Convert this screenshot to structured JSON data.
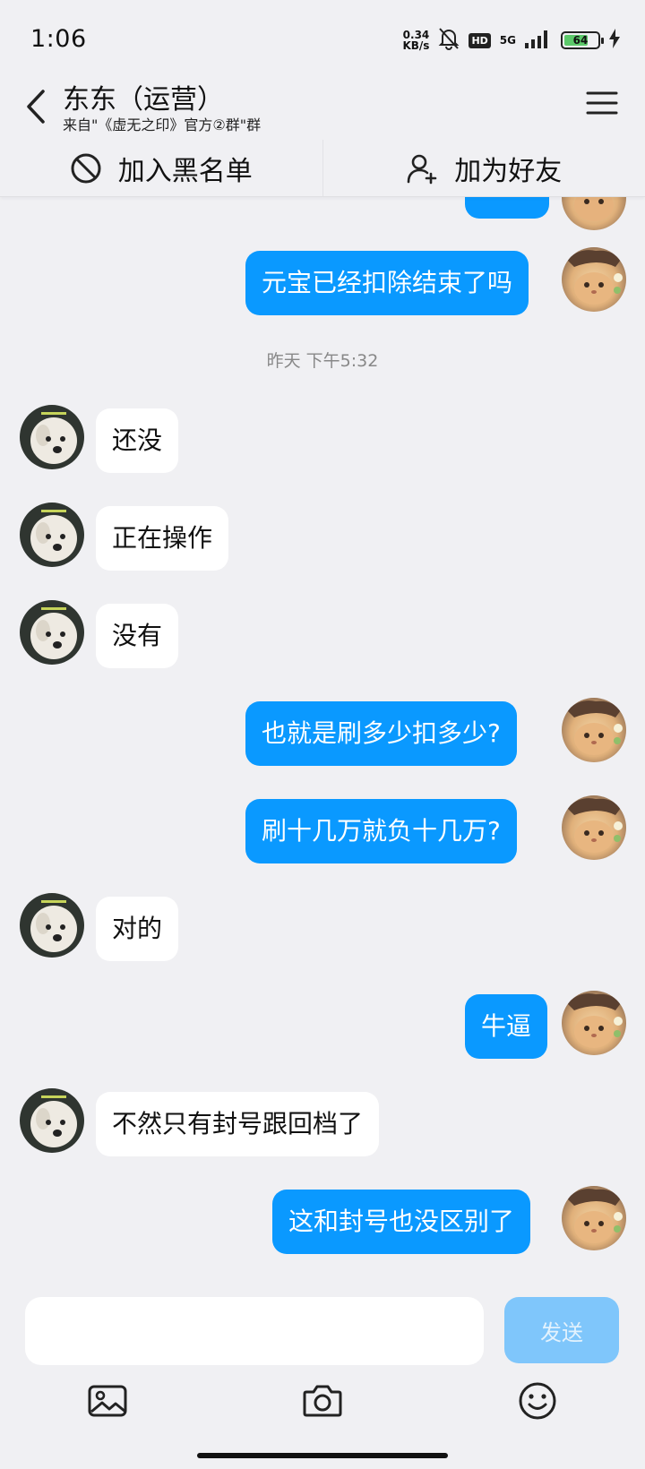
{
  "status_bar": {
    "time": "1:06",
    "net_speed_value": "0.34",
    "net_speed_unit": "KB/s",
    "hd": "HD",
    "signal": "5G",
    "battery": "64"
  },
  "header": {
    "title": "东东（运营）",
    "subtitle": "来自\"《虚无之印》官方②群\"群"
  },
  "actions": {
    "blacklist_label": "加入黑名单",
    "add_friend_label": "加为好友"
  },
  "chat": {
    "timestamp": "昨天 下午5:32",
    "messages": [
      {
        "side": "out",
        "text": "元宝已经扣除结束了吗"
      },
      {
        "side": "in",
        "text": "还没"
      },
      {
        "side": "in",
        "text": "正在操作"
      },
      {
        "side": "in",
        "text": "没有"
      },
      {
        "side": "out",
        "text": "也就是刷多少扣多少?"
      },
      {
        "side": "out",
        "text": "刷十几万就负十几万?"
      },
      {
        "side": "in",
        "text": "对的"
      },
      {
        "side": "out",
        "text": "牛逼"
      },
      {
        "side": "in",
        "text": "不然只有封号跟回档了"
      },
      {
        "side": "out",
        "text": "这和封号也没区别了"
      }
    ]
  },
  "input": {
    "placeholder": "",
    "send_label": "发送"
  },
  "colors": {
    "outgoing_bubble": "#0a99ff",
    "incoming_bubble": "#ffffff",
    "background": "#f0f0f3",
    "send_button": "#7fc6fb"
  },
  "icons": {
    "back": "chevron-left-icon",
    "menu": "hamburger-menu-icon",
    "blacklist": "prohibited-icon",
    "add_friend": "add-user-icon",
    "image": "image-icon",
    "camera": "camera-icon",
    "emoji": "emoji-icon"
  }
}
